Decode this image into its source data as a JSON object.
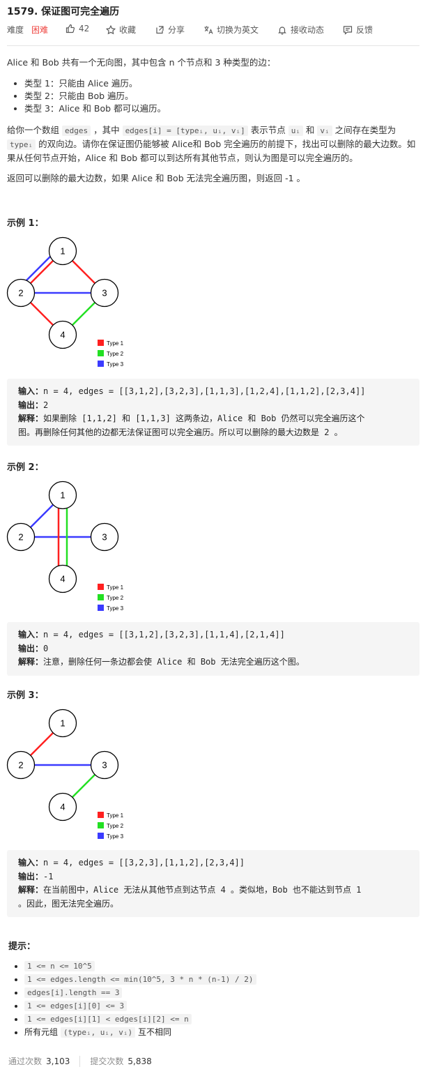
{
  "problem": {
    "title": "1579. 保证图可完全遍历",
    "difficulty_label": "难度",
    "difficulty": "困难",
    "likes": "42",
    "collect": "收藏",
    "share": "分享",
    "switch_lang": "切换为英文",
    "notify": "接收动态",
    "feedback": "反馈"
  },
  "description": {
    "intro": "Alice 和 Bob 共有一个无向图，其中包含 n 个节点和 3  种类型的边：",
    "types": [
      "类型 1：只能由 Alice 遍历。",
      "类型 2：只能由 Bob 遍历。",
      "类型 3：Alice 和 Bob 都可以遍历。"
    ],
    "p2_a": "给你一个数组 ",
    "p2_code1": "edges",
    "p2_b": " ，其中 ",
    "p2_code2": "edges[i] = [typeᵢ, uᵢ, vᵢ]",
    "p2_c": " 表示节点 ",
    "p2_code3": "uᵢ",
    "p2_d": " 和 ",
    "p2_code4": "vᵢ",
    "p2_e": " 之间存在类型为 ",
    "p2_code5": "typeᵢ",
    "p2_f": " 的双向边。请你在保证图仍能够被 Alice和 Bob 完全遍历的前提下，找出可以删除的最大边数。如果从任何节点开始，Alice 和 Bob 都可以到达所有其他节点，则认为图是可以完全遍历的。",
    "p3": "返回可以删除的最大边数，如果 Alice 和 Bob 无法完全遍历图，则返回 -1 。"
  },
  "legend": [
    "Type 1",
    "Type 2",
    "Type 3"
  ],
  "colors": {
    "type1": "#ff2020",
    "type2": "#22e022",
    "type3": "#3b3bff"
  },
  "examples": [
    {
      "title": "示例 1：",
      "input_label": "输入：",
      "input": "n = 4, edges = [[3,1,2],[3,2,3],[1,1,3],[1,2,4],[1,1,2],[2,3,4]]",
      "output_label": "输出：",
      "output": "2",
      "explain_label": "解释：",
      "explain_lines": [
        "如果删除 [1,1,2] 和 [1,1,3] 这两条边，Alice 和 Bob 仍然可以完全遍历这个",
        "图。再删除任何其他的边都无法保证图可以完全遍历。所以可以删除的最大边数是 2 。"
      ]
    },
    {
      "title": "示例 2：",
      "input_label": "输入：",
      "input": "n = 4, edges = [[3,1,2],[3,2,3],[1,1,4],[2,1,4]]",
      "output_label": "输出：",
      "output": "0",
      "explain_label": "解释：",
      "explain_lines": [
        "注意，删除任何一条边都会使 Alice 和 Bob 无法完全遍历这个图。"
      ]
    },
    {
      "title": "示例 3：",
      "input_label": "输入：",
      "input": "n = 4, edges = [[3,2,3],[1,1,2],[2,3,4]]",
      "output_label": "输出：",
      "output": "-1",
      "explain_label": "解释：",
      "explain_lines": [
        "在当前图中，Alice 无法从其他节点到达节点 4 。类似地，Bob 也不能达到节点 1",
        "。因此，图无法完全遍历。"
      ]
    }
  ],
  "graph_nodes": [
    "1",
    "2",
    "3",
    "4"
  ],
  "hints": {
    "title": "提示：",
    "items": [
      "1 <= n <= 10^5",
      "1 <= edges.length <= min(10^5, 3 * n * (n-1) / 2)",
      "edges[i].length == 3",
      "1 <= edges[i][0] <= 3",
      "1 <= edges[i][1] < edges[i][2] <= n"
    ],
    "last_a": "所有元组 ",
    "last_code": "(typeᵢ, uᵢ, vᵢ)",
    "last_b": " 互不相同"
  },
  "stats": {
    "accepted_label": "通过次数",
    "accepted": "3,103",
    "submitted_label": "提交次数",
    "submitted": "5,838"
  }
}
